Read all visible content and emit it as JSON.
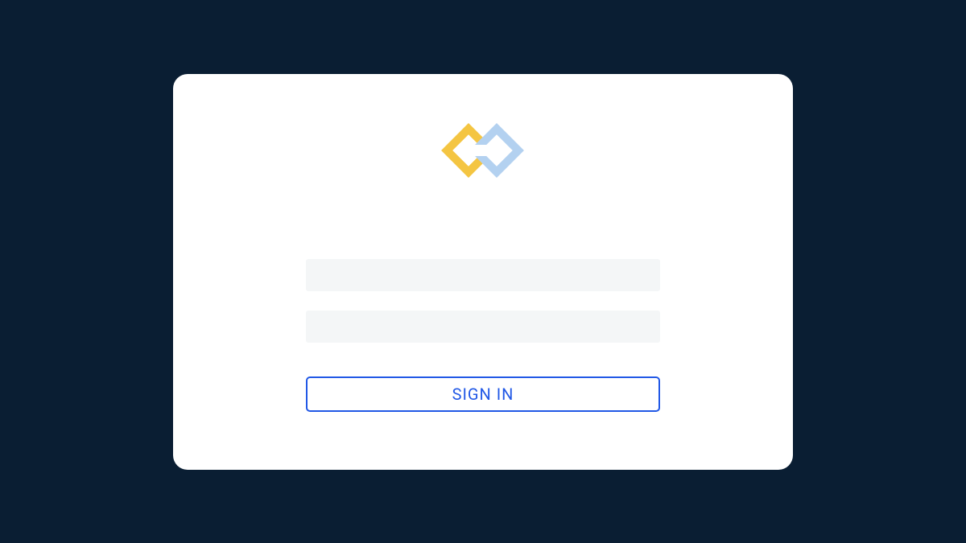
{
  "login": {
    "username_placeholder": "",
    "username_value": "",
    "password_placeholder": "",
    "password_value": "",
    "signin_label": "SIGN IN"
  },
  "colors": {
    "background": "#0a1e33",
    "card": "#ffffff",
    "input_bg": "#f4f6f7",
    "button_border": "#2158e6",
    "button_text": "#2158e6",
    "logo_yellow": "#f4c542",
    "logo_blue": "#b3d1f0"
  },
  "icons": {
    "logo": "exchange-arrows-icon"
  }
}
